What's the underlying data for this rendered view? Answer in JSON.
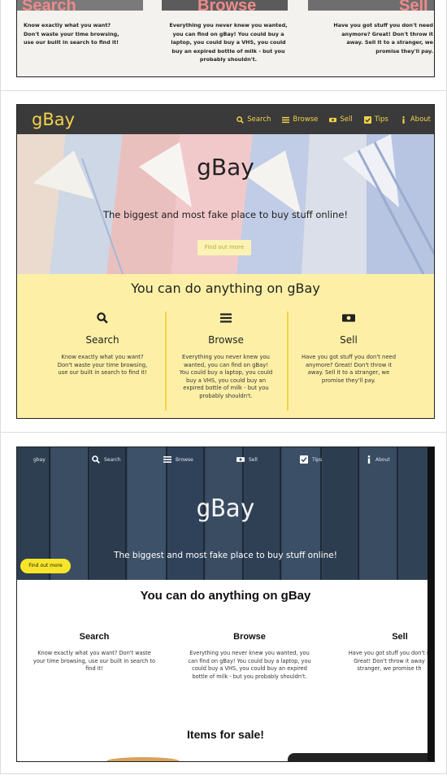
{
  "shot1": {
    "columns": [
      {
        "title": "Search",
        "text": "Know exactly what you want?\nDon't waste your time browsing,\nuse our built in search to find it!"
      },
      {
        "title": "Browse",
        "text": "Everything you never knew you wanted,\nyou can find on gBay! You could buy a\nlaptop, you could buy a VHS, you could\nbuy an expired bottle of milk - but you\nprobably shouldn't."
      },
      {
        "title": "Sell",
        "text": "Have you got stuff you don't need\nanymore? Great! Don't throw it\naway. Sell it to a stranger, we\npromise they'll pay."
      }
    ]
  },
  "shot2": {
    "logo": "gBay",
    "nav": [
      {
        "label": "Search",
        "icon": "search-icon"
      },
      {
        "label": "Browse",
        "icon": "list-icon"
      },
      {
        "label": "Sell",
        "icon": "money-icon"
      },
      {
        "label": "Tips",
        "icon": "check-square-icon"
      },
      {
        "label": "About",
        "icon": "info-icon"
      }
    ],
    "hero": {
      "title": "gBay",
      "subtitle": "The biggest and most fake place to buy stuff online!",
      "button": "Find out more"
    },
    "section": {
      "heading": "You can do anything on gBay",
      "columns": [
        {
          "title": "Search",
          "icon": "search-icon",
          "text": "Know exactly what you want?\nDon't waste your time browsing,\nuse our built in search to find it!"
        },
        {
          "title": "Browse",
          "icon": "list-icon",
          "text": "Everything you never knew you\nwanted, you can find on gBay!\nYou could buy a laptop, you could\nbuy a VHS, you could buy an\nexpired bottle of milk - but you\nprobably shouldn't."
        },
        {
          "title": "Sell",
          "icon": "money-icon",
          "text": "Have you got stuff you don't need\nanymore? Great! Don't throw it\naway. Sell it to a stranger, we\npromise they'll pay."
        }
      ]
    },
    "colors": {
      "nav_bg": "#3a3a3a",
      "accent": "#f3d24a",
      "section_bg": "#fdf0a6"
    }
  },
  "shot3": {
    "nav": {
      "logo": "gbay",
      "items": [
        {
          "label": "Search",
          "icon": "search-icon"
        },
        {
          "label": "Browse",
          "icon": "list-icon"
        },
        {
          "label": "Sell",
          "icon": "money-icon"
        },
        {
          "label": "Tips",
          "icon": "check-square-icon"
        },
        {
          "label": "About",
          "icon": "info-icon"
        }
      ]
    },
    "hero": {
      "title": "gBay",
      "subtitle": "The biggest and most fake place to buy stuff online!",
      "button": "Find out more"
    },
    "section": {
      "heading": "You can do anything on gBay",
      "columns": [
        {
          "title": "Search",
          "text": "Know exactly what you want? Don't waste\nyour time browsing, use our built in search to\nfind it!"
        },
        {
          "title": "Browse",
          "text": "Everything you never knew you wanted, you\ncan find on gBay! You could buy a laptop, you\ncould buy a VHS, you could buy an expired\nbottle of milk - but you probably shouldn't."
        },
        {
          "title": "Sell",
          "text": "Have you got stuff you don't n\nGreat! Don't throw it away\nstranger, we promise th"
        }
      ],
      "items_heading": "Items for sale!"
    },
    "colors": {
      "hero_bg": "#34465a",
      "button": "#f7e52a"
    }
  }
}
